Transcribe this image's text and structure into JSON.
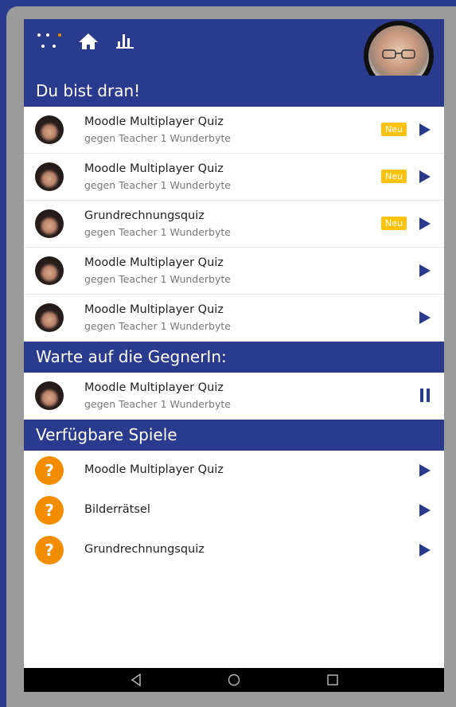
{
  "header": {
    "section_title": "Du bist dran!",
    "icons": [
      "dots-icon",
      "home-icon",
      "stats-icon"
    ]
  },
  "your_turn": [
    {
      "title": "Moodle Multiplayer Quiz",
      "opponent": "gegen Teacher 1 Wunderbyte",
      "badge": "Neu"
    },
    {
      "title": "Moodle Multiplayer Quiz",
      "opponent": "gegen Teacher 1 Wunderbyte",
      "badge": "Neu"
    },
    {
      "title": "Grundrechnungsquiz",
      "opponent": "gegen Teacher 1 Wunderbyte",
      "badge": "Neu"
    },
    {
      "title": "Moodle Multiplayer Quiz",
      "opponent": "gegen Teacher 1 Wunderbyte"
    },
    {
      "title": "Moodle Multiplayer Quiz",
      "opponent": "gegen Teacher 1 Wunderbyte"
    }
  ],
  "waiting": {
    "section_title": "Warte auf die GegnerIn:",
    "items": [
      {
        "title": "Moodle Multiplayer Quiz",
        "opponent": "gegen Teacher 1 Wunderbyte"
      }
    ]
  },
  "available": {
    "section_title": "Verfügbare Spiele",
    "items": [
      {
        "title": "Moodle Multiplayer Quiz",
        "icon": "?"
      },
      {
        "title": "Bilderrätsel",
        "icon": "?"
      },
      {
        "title": "Grundrechnungsquiz",
        "icon": "?"
      }
    ]
  },
  "colors": {
    "primary": "#2a3a8c",
    "accent": "#f28c00",
    "badge": "#ffc20e"
  }
}
